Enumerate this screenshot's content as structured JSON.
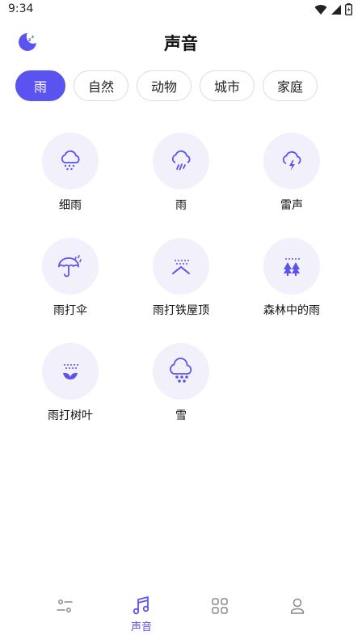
{
  "status": {
    "time": "9:34"
  },
  "header": {
    "title": "声音"
  },
  "tabs": [
    {
      "label": "雨",
      "active": true
    },
    {
      "label": "自然",
      "active": false
    },
    {
      "label": "动物",
      "active": false
    },
    {
      "label": "城市",
      "active": false
    },
    {
      "label": "家庭",
      "active": false
    }
  ],
  "sounds": [
    {
      "label": "细雨",
      "icon": "light-rain-cloud-icon"
    },
    {
      "label": "雨",
      "icon": "rain-cloud-icon"
    },
    {
      "label": "雷声",
      "icon": "thunder-cloud-icon"
    },
    {
      "label": "雨打伞",
      "icon": "umbrella-rain-icon"
    },
    {
      "label": "雨打铁屋顶",
      "icon": "roof-rain-icon"
    },
    {
      "label": "森林中的雨",
      "icon": "forest-rain-icon"
    },
    {
      "label": "雨打树叶",
      "icon": "leaf-rain-icon"
    },
    {
      "label": "雪",
      "icon": "snow-cloud-icon"
    }
  ],
  "nav": [
    {
      "label": "",
      "icon": "settings-sliders-icon"
    },
    {
      "label": "声音",
      "icon": "music-note-icon",
      "active": true
    },
    {
      "label": "",
      "icon": "grid-icon"
    },
    {
      "label": "",
      "icon": "profile-icon"
    }
  ],
  "colors": {
    "accent": "#5b53f0",
    "circle_bg": "#f1f0fb"
  }
}
